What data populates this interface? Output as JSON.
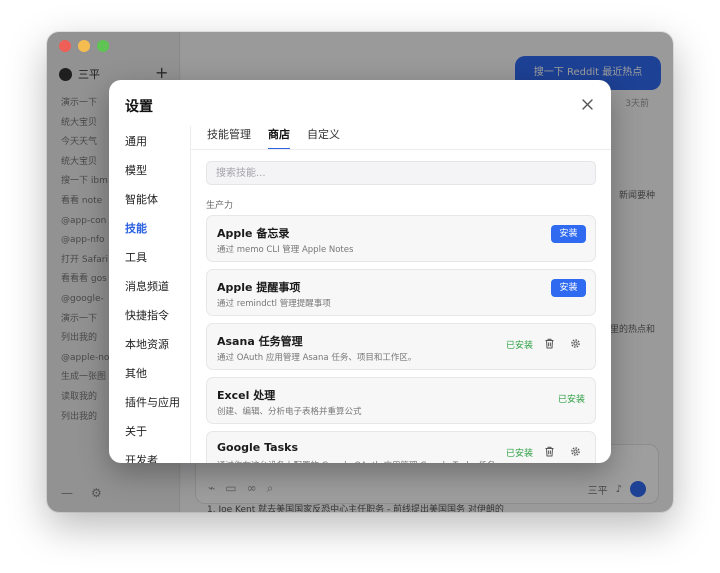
{
  "background_app": {
    "app_name": "三平",
    "sidebar_items": [
      "演示一下",
      "统大宝贝",
      "今天天气",
      "统大宝贝",
      "搜一下 ibm",
      "看看 note",
      "@app-con",
      "@app-nfo",
      "打开 Safari",
      "看看看 gos",
      "@google-",
      "演示一下",
      "列出我的",
      "@apple-no",
      "生成一张图",
      "读取我的",
      "列出我的"
    ],
    "bubble_text": "搜一下 Reddit 最近热点",
    "time_label": "3天前",
    "fragment1": "新闻要种",
    "fragment2": "里的热点和",
    "composer_model": "三平",
    "bottom_line": "1. Joe Kent 就去美国国家反恐中心主任职务 - 前线提出美国国务 对伊朗的"
  },
  "dialog": {
    "title": "设置",
    "nav": [
      "通用",
      "模型",
      "智能体",
      "技能",
      "工具",
      "消息频道",
      "快捷指令",
      "本地资源",
      "其他",
      "插件与应用",
      "关于",
      "开发者"
    ],
    "active_nav": "技能",
    "tabs": [
      "技能管理",
      "商店",
      "自定义"
    ],
    "active_tab": "商店",
    "search_placeholder": "搜索技能...",
    "section_label": "生产力",
    "install_label": "安装",
    "installed_label": "已安装",
    "skills": [
      {
        "name": "Apple 备忘录",
        "desc": "通过 memo CLI 管理 Apple Notes",
        "installed": false
      },
      {
        "name": "Apple 提醒事项",
        "desc": "通过 remindctl 管理提醒事项",
        "installed": false
      },
      {
        "name": "Asana 任务管理",
        "desc": "通过 OAuth 应用管理 Asana 任务、项目和工作区。",
        "installed": true,
        "actions": true
      },
      {
        "name": "Excel 处理",
        "desc": "创建、编辑、分析电子表格并重算公式",
        "installed": true,
        "actions": false
      },
      {
        "name": "Google Tasks",
        "desc": "通过你在这台设备上配置的 Google OAuth 应用管理 Google Tasks 任务",
        "installed": true,
        "actions": true
      }
    ]
  },
  "colors": {
    "accent": "#2f6af0",
    "installed": "#2ea043"
  }
}
